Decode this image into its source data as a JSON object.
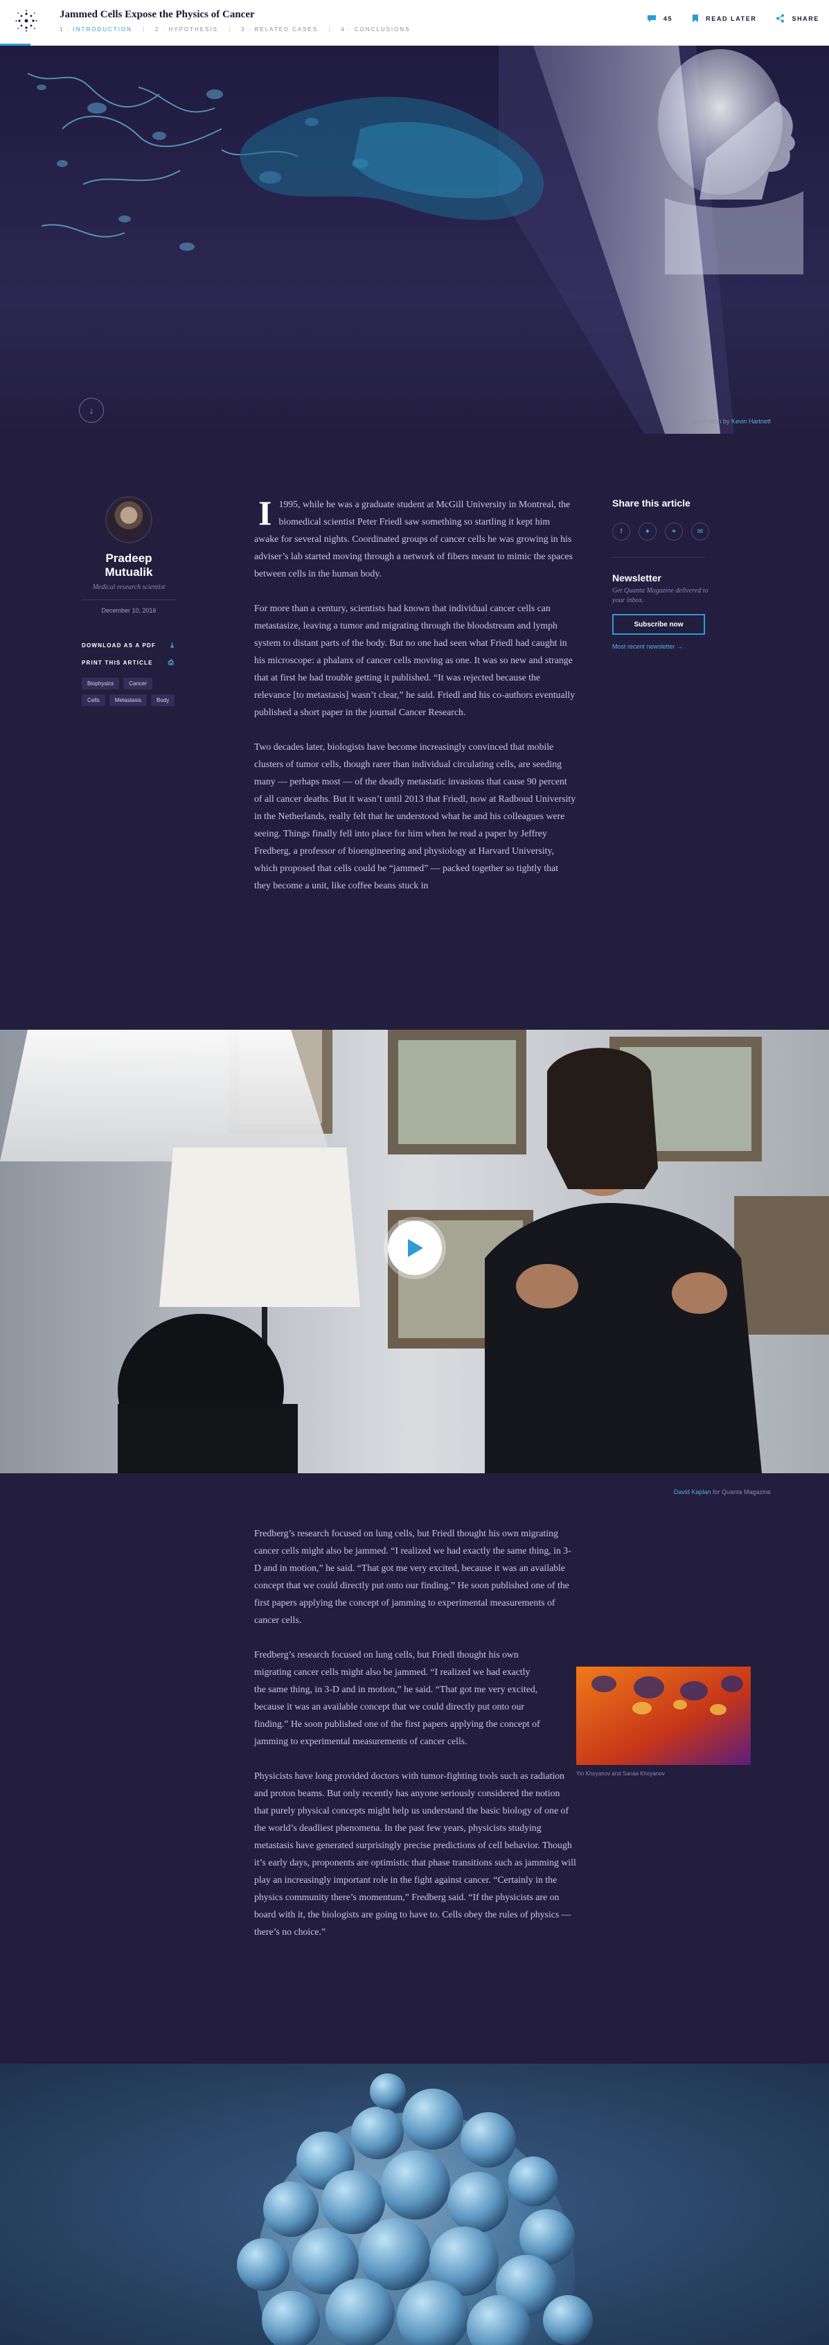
{
  "header": {
    "title": "Jammed Cells Expose the Physics of Cancer",
    "toc": [
      "1 · INTRODUCTION",
      "2 · HYPOTHESIS",
      "3 · RELATED CASES",
      "4 · CONCLUSIONS"
    ],
    "comment_count": "45",
    "read_later": "READ LATER",
    "share": "SHARE"
  },
  "hero": {
    "credit_prefix": "Illustration by",
    "credit_name": "Kevin Hartnett"
  },
  "author": {
    "name": "Pradeep Mutualik",
    "role": "Medical research scientist",
    "date": "December 10, 2016",
    "download_pdf": "DOWNLOAD AS A PDF",
    "print_article": "PRINT THIS ARTICLE",
    "tags": [
      "Biophysics",
      "Cancer",
      "Cells",
      "Metastasis",
      "Body"
    ]
  },
  "article": {
    "dropcap": "I",
    "p1": "1995, while he was a graduate student at McGill University in Montreal, the biomedical scientist Peter Friedl saw something so startling it kept him awake for several nights. Coordinated groups of cancer cells he was growing in his adviser’s lab started moving through a network of fibers meant to mimic the spaces between cells in the human body.",
    "p2": "For more than a century, scientists had known that individual cancer cells can metastasize, leaving a tumor and migrating through the bloodstream and lymph system to distant parts of the body. But no one had seen what Friedl had caught in his microscope: a phalanx of cancer cells moving as one. It was so new and strange that at first he had trouble getting it published. “It was rejected because the relevance [to metastasis] wasn’t clear,” he said. Friedl and his co-authors eventually published a short paper in the journal Cancer Research.",
    "p3": "Two decades later, biologists have become increasingly convinced that mobile clusters of tumor cells, though rarer than individual circulating cells, are seeding many — perhaps most — of the deadly metastatic invasions that cause 90 percent of all cancer deaths. But it wasn’t until 2013 that Friedl, now at Radboud University in the Netherlands, really felt that he understood what he and his colleagues were seeing. Things finally fell into place for him when he read a paper by Jeffrey Fredberg, a professor of bioengineering and physiology at Harvard University, which proposed that cells could be “jammed” — packed together so tightly that they become a unit, like coffee beans stuck in"
  },
  "sidebar_right": {
    "share_title": "Share this article",
    "share_icons": [
      "facebook-icon",
      "twitter-icon",
      "link-icon",
      "email-icon"
    ],
    "newsletter_title": "Newsletter",
    "newsletter_copy": "Get Quanta Magazine delivered to your inbox.",
    "subscribe": "Subscribe now",
    "recent": "Most recent newsletter →"
  },
  "video": {
    "credit_name": "David Kaplan",
    "credit_suffix": "for Quanta Magazine"
  },
  "article2": {
    "p1": "Fredberg’s research focused on lung cells, but Friedl thought his own migrating cancer cells might also be jammed. “I realized we had exactly the same thing, in 3-D and in motion,” he said. “That got me very excited, because it was an available concept that we could directly put onto our finding.” He soon published one of the first papers applying the concept of jamming to experimental measurements of cancer cells.",
    "p2": "Fredberg’s research focused on lung cells, but Friedl thought his own migrating cancer cells might also be jammed. “I realized we had exactly the same thing, in 3-D and in motion,” he said. “That got me very excited, because it was an available concept that we could directly put onto our finding.” He soon published one of the first papers applying the concept of jamming to experimental measurements of cancer cells.",
    "p3": "Physicists have long provided doctors with tumor-fighting tools such as radiation and proton beams. But only recently has anyone seriously considered the notion that purely physical concepts might help us understand the basic biology of one of the world’s deadliest phenomena. In the past few years, physicists studying metastasis have generated surprisingly precise predictions of cell behavior. Though it’s early days, proponents are optimistic that phase transitions such as jamming will play an increasingly important role in the fight against cancer. “Certainly in the physics community there’s momentum,” Fredberg said. “If the physicists are on board with it, the biologists are going to have to. Cells obey the rules of physics — there’s no choice.”",
    "figure_caption": "Yin Khoyanov and Sanaa Khoyanov"
  },
  "colors": {
    "accent": "#2e9bd6",
    "background": "#231d3e",
    "header": "#ffffff"
  }
}
